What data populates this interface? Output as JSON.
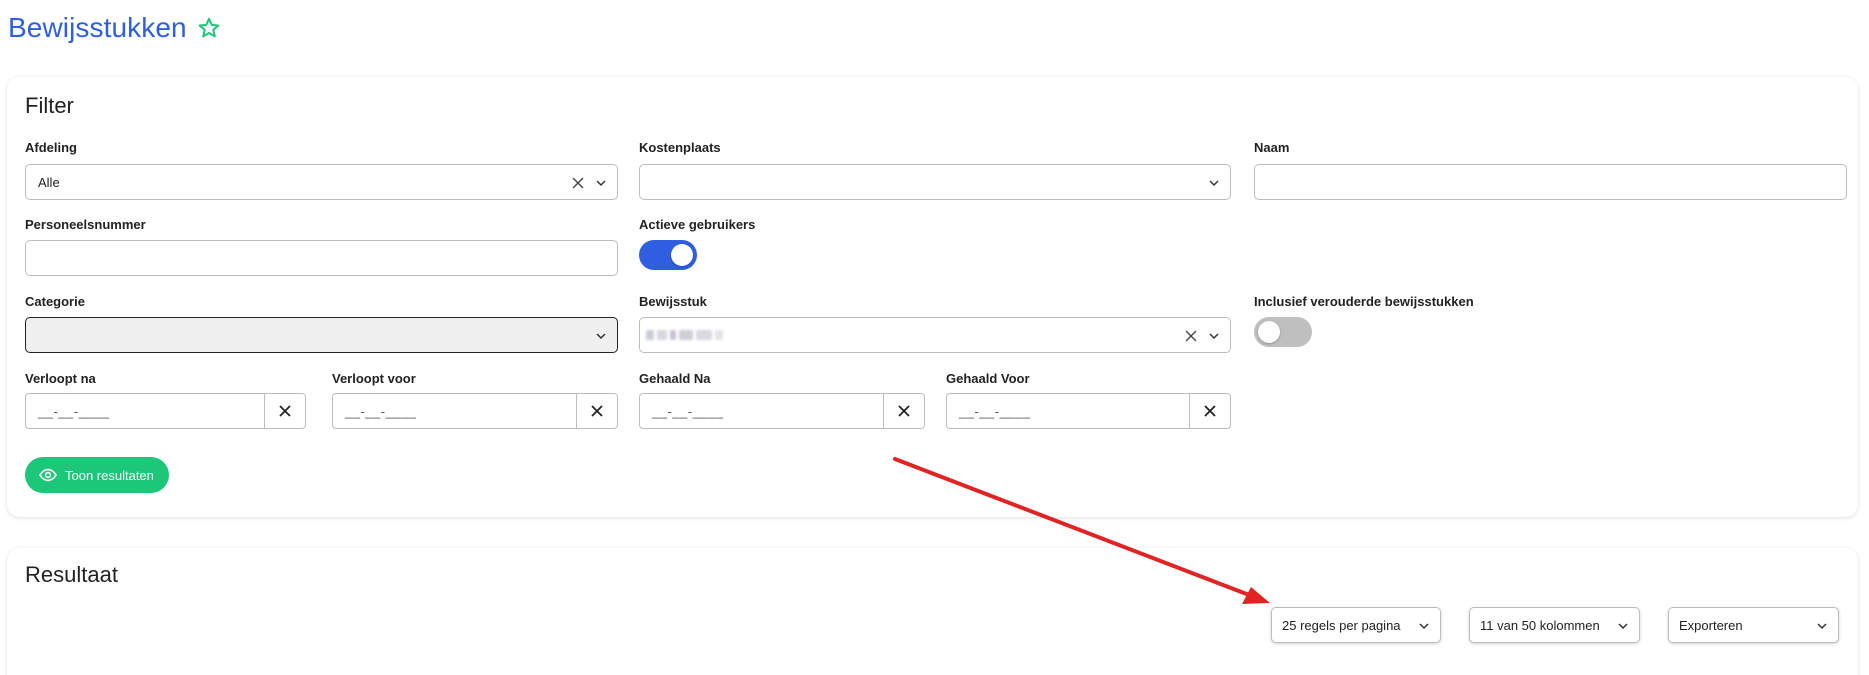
{
  "page": {
    "title": "Bewijsstukken",
    "accent_color": "#2f5fe0",
    "star_color": "#1dc77a",
    "favorite_icon": "star-outline-icon"
  },
  "filter": {
    "title": "Filter",
    "afdeling": {
      "label": "Afdeling",
      "value": "Alle"
    },
    "kostenplaats": {
      "label": "Kostenplaats",
      "value": ""
    },
    "naam": {
      "label": "Naam",
      "value": ""
    },
    "personeelsnummer": {
      "label": "Personeelsnummer",
      "value": ""
    },
    "actieve_gebruikers": {
      "label": "Actieve gebruikers",
      "on": true
    },
    "categorie": {
      "label": "Categorie",
      "value": ""
    },
    "bewijsstuk": {
      "label": "Bewijsstuk",
      "value_redacted": true
    },
    "inclusief_verouderd": {
      "label": "Inclusief verouderde bewijsstukken",
      "on": false
    },
    "verloopt_na": {
      "label": "Verloopt na",
      "mask": "__-__-____"
    },
    "verloopt_voor": {
      "label": "Verloopt voor",
      "mask": "__-__-____"
    },
    "gehaald_na": {
      "label": "Gehaald Na",
      "mask": "__-__-____"
    },
    "gehaald_voor": {
      "label": "Gehaald Voor",
      "mask": "__-__-____"
    },
    "show_button": {
      "label": "Toon resultaten",
      "icon": "eye-icon",
      "color": "#1dc77a"
    }
  },
  "result": {
    "title": "Resultaat",
    "rows_per_page": "25 regels per pagina",
    "columns": "11 van 50 kolommen",
    "export": "Exporteren"
  },
  "annotation": {
    "arrow_color": "#e02424"
  }
}
